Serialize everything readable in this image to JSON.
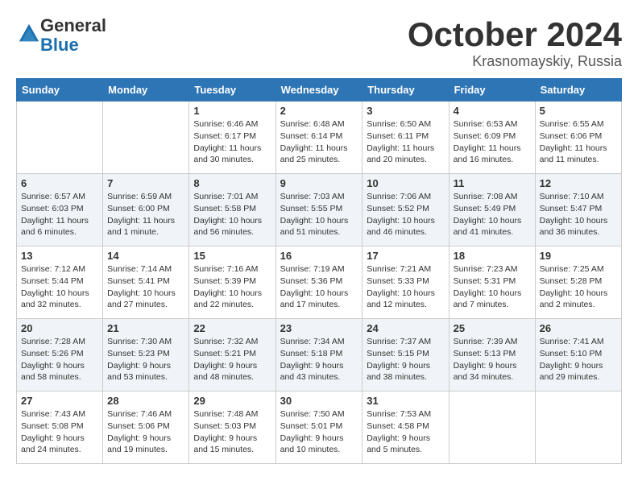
{
  "header": {
    "logo_line1": "General",
    "logo_line2": "Blue",
    "month": "October 2024",
    "location": "Krasnomayskiy, Russia"
  },
  "days_of_week": [
    "Sunday",
    "Monday",
    "Tuesday",
    "Wednesday",
    "Thursday",
    "Friday",
    "Saturday"
  ],
  "weeks": [
    [
      {
        "day": "",
        "info": ""
      },
      {
        "day": "",
        "info": ""
      },
      {
        "day": "1",
        "info": "Sunrise: 6:46 AM\nSunset: 6:17 PM\nDaylight: 11 hours and 30 minutes."
      },
      {
        "day": "2",
        "info": "Sunrise: 6:48 AM\nSunset: 6:14 PM\nDaylight: 11 hours and 25 minutes."
      },
      {
        "day": "3",
        "info": "Sunrise: 6:50 AM\nSunset: 6:11 PM\nDaylight: 11 hours and 20 minutes."
      },
      {
        "day": "4",
        "info": "Sunrise: 6:53 AM\nSunset: 6:09 PM\nDaylight: 11 hours and 16 minutes."
      },
      {
        "day": "5",
        "info": "Sunrise: 6:55 AM\nSunset: 6:06 PM\nDaylight: 11 hours and 11 minutes."
      }
    ],
    [
      {
        "day": "6",
        "info": "Sunrise: 6:57 AM\nSunset: 6:03 PM\nDaylight: 11 hours and 6 minutes."
      },
      {
        "day": "7",
        "info": "Sunrise: 6:59 AM\nSunset: 6:00 PM\nDaylight: 11 hours and 1 minute."
      },
      {
        "day": "8",
        "info": "Sunrise: 7:01 AM\nSunset: 5:58 PM\nDaylight: 10 hours and 56 minutes."
      },
      {
        "day": "9",
        "info": "Sunrise: 7:03 AM\nSunset: 5:55 PM\nDaylight: 10 hours and 51 minutes."
      },
      {
        "day": "10",
        "info": "Sunrise: 7:06 AM\nSunset: 5:52 PM\nDaylight: 10 hours and 46 minutes."
      },
      {
        "day": "11",
        "info": "Sunrise: 7:08 AM\nSunset: 5:49 PM\nDaylight: 10 hours and 41 minutes."
      },
      {
        "day": "12",
        "info": "Sunrise: 7:10 AM\nSunset: 5:47 PM\nDaylight: 10 hours and 36 minutes."
      }
    ],
    [
      {
        "day": "13",
        "info": "Sunrise: 7:12 AM\nSunset: 5:44 PM\nDaylight: 10 hours and 32 minutes."
      },
      {
        "day": "14",
        "info": "Sunrise: 7:14 AM\nSunset: 5:41 PM\nDaylight: 10 hours and 27 minutes."
      },
      {
        "day": "15",
        "info": "Sunrise: 7:16 AM\nSunset: 5:39 PM\nDaylight: 10 hours and 22 minutes."
      },
      {
        "day": "16",
        "info": "Sunrise: 7:19 AM\nSunset: 5:36 PM\nDaylight: 10 hours and 17 minutes."
      },
      {
        "day": "17",
        "info": "Sunrise: 7:21 AM\nSunset: 5:33 PM\nDaylight: 10 hours and 12 minutes."
      },
      {
        "day": "18",
        "info": "Sunrise: 7:23 AM\nSunset: 5:31 PM\nDaylight: 10 hours and 7 minutes."
      },
      {
        "day": "19",
        "info": "Sunrise: 7:25 AM\nSunset: 5:28 PM\nDaylight: 10 hours and 2 minutes."
      }
    ],
    [
      {
        "day": "20",
        "info": "Sunrise: 7:28 AM\nSunset: 5:26 PM\nDaylight: 9 hours and 58 minutes."
      },
      {
        "day": "21",
        "info": "Sunrise: 7:30 AM\nSunset: 5:23 PM\nDaylight: 9 hours and 53 minutes."
      },
      {
        "day": "22",
        "info": "Sunrise: 7:32 AM\nSunset: 5:21 PM\nDaylight: 9 hours and 48 minutes."
      },
      {
        "day": "23",
        "info": "Sunrise: 7:34 AM\nSunset: 5:18 PM\nDaylight: 9 hours and 43 minutes."
      },
      {
        "day": "24",
        "info": "Sunrise: 7:37 AM\nSunset: 5:15 PM\nDaylight: 9 hours and 38 minutes."
      },
      {
        "day": "25",
        "info": "Sunrise: 7:39 AM\nSunset: 5:13 PM\nDaylight: 9 hours and 34 minutes."
      },
      {
        "day": "26",
        "info": "Sunrise: 7:41 AM\nSunset: 5:10 PM\nDaylight: 9 hours and 29 minutes."
      }
    ],
    [
      {
        "day": "27",
        "info": "Sunrise: 7:43 AM\nSunset: 5:08 PM\nDaylight: 9 hours and 24 minutes."
      },
      {
        "day": "28",
        "info": "Sunrise: 7:46 AM\nSunset: 5:06 PM\nDaylight: 9 hours and 19 minutes."
      },
      {
        "day": "29",
        "info": "Sunrise: 7:48 AM\nSunset: 5:03 PM\nDaylight: 9 hours and 15 minutes."
      },
      {
        "day": "30",
        "info": "Sunrise: 7:50 AM\nSunset: 5:01 PM\nDaylight: 9 hours and 10 minutes."
      },
      {
        "day": "31",
        "info": "Sunrise: 7:53 AM\nSunset: 4:58 PM\nDaylight: 9 hours and 5 minutes."
      },
      {
        "day": "",
        "info": ""
      },
      {
        "day": "",
        "info": ""
      }
    ]
  ]
}
